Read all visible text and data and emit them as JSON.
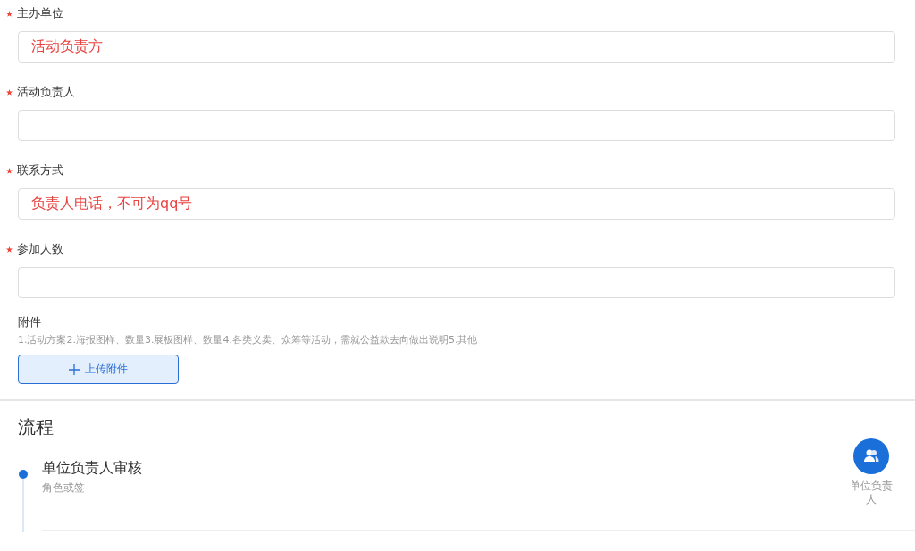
{
  "fields": [
    {
      "label": "主办单位",
      "required": true,
      "value": "活动负责方"
    },
    {
      "label": "活动负责人",
      "required": true
    },
    {
      "label": "联系方式",
      "required": true,
      "value": "负责人电话，不可为qq号"
    },
    {
      "label": "参加人数",
      "required": true
    }
  ],
  "attachment": {
    "label": "附件",
    "required": false,
    "hint": "1.活动方案2.海报图样、数量3.展板图样、数量4.各类义卖、众筹等活动，需就公益款去向做出说明5.其他",
    "button": "上传附件"
  },
  "flow": {
    "title": "流程",
    "steps": [
      {
        "title": "单位负责人审核",
        "subtitle": "角色或签",
        "approver": "单位负责人"
      }
    ]
  }
}
